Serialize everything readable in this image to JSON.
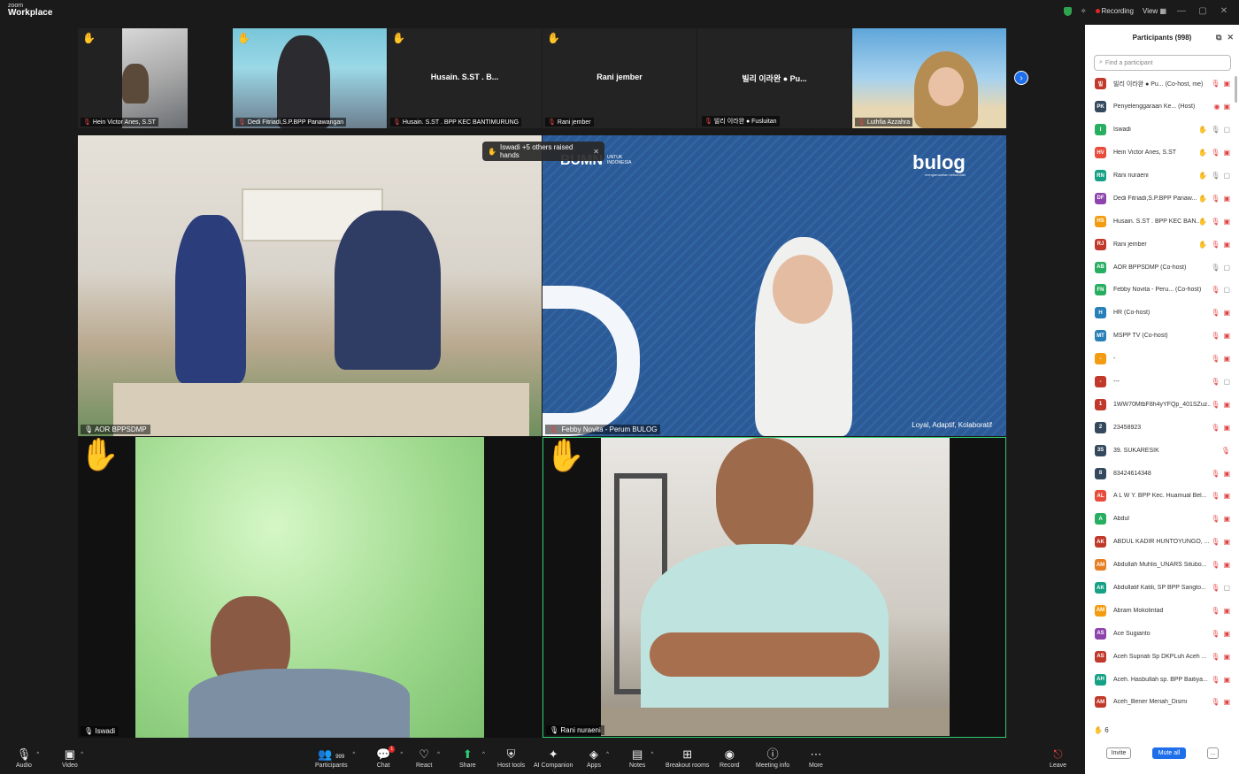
{
  "app": {
    "brand_small": "zoom",
    "brand_big": "Workplace",
    "recording": "Recording",
    "view": "View"
  },
  "toast": {
    "text": "Iswadi +5 others raised hands"
  },
  "thumbs": [
    {
      "name": "Hein Victor Anes, S.ST"
    },
    {
      "name": "Dedi Fitriadi,S.P.BPP Panawangan"
    },
    {
      "name": "Husain. S.ST . BPP KEC BANTIMURUNG",
      "center": "Husain. S.ST . B..."
    },
    {
      "name": "Rani jember",
      "center": "Rani jember"
    },
    {
      "name": "빌리 이라완 ● Fusluitan",
      "center": "빌리 이라완 ● Pu..."
    },
    {
      "name": "Luthfia Azzahra"
    }
  ],
  "tiles": [
    {
      "name": "AOR BPPSDMP"
    },
    {
      "name": "Febby Novita - Perum BULOG",
      "logo": "bulog",
      "logo_sub": "mengamankan kebutuhan",
      "tagline": "Loyal, Adaptif, Kolaboratif",
      "bumn1": "UNTUK",
      "bumn2": "INDONESIA"
    },
    {
      "name": "Iswadi"
    },
    {
      "name": "Rani nuraeni"
    }
  ],
  "sidebar": {
    "title": "Participants (998)",
    "search_placeholder": "Find a participant",
    "raised_count": "6",
    "invite": "Invite",
    "mute_all": "Mute all",
    "more": "...",
    "participants": [
      {
        "initials": "빌",
        "color": "#c0392b",
        "name": "빌리 이라완 ● Pu... (Co-host, me)",
        "s": [
          "mic",
          "cam"
        ]
      },
      {
        "initials": "PK",
        "color": "#34495e",
        "name": "Penyelenggaraan Ke... (Host)",
        "s": [
          "rec",
          "cam"
        ]
      },
      {
        "initials": "I",
        "color": "#27ae60",
        "name": "Iswadi",
        "s": [
          "hand",
          "okmic",
          "okcam"
        ]
      },
      {
        "initials": "HV",
        "color": "#e74c3c",
        "name": "Hein Victor Anes, S.ST",
        "s": [
          "hand",
          "mic",
          "cam"
        ]
      },
      {
        "initials": "RN",
        "color": "#16a085",
        "name": "Rani nuraeni",
        "s": [
          "hand",
          "okmic",
          "okcam"
        ]
      },
      {
        "initials": "DF",
        "color": "#8e44ad",
        "name": "Dedi Fitriadi,S.P.BPP Panaw...",
        "s": [
          "hand",
          "mic",
          "cam"
        ]
      },
      {
        "initials": "HS",
        "color": "#f39c12",
        "name": "Husain. S.ST . BPP KEC BAN...",
        "s": [
          "hand",
          "mic",
          "cam"
        ]
      },
      {
        "initials": "RJ",
        "color": "#c0392b",
        "name": "Rani jember",
        "s": [
          "hand",
          "mic",
          "cam"
        ]
      },
      {
        "initials": "AB",
        "color": "#27ae60",
        "name": "AOR BPPSDMP (Co-host)",
        "s": [
          "okmic",
          "okcam"
        ]
      },
      {
        "initials": "FN",
        "color": "#27ae60",
        "name": "Febby Novita - Peru... (Co-host)",
        "s": [
          "mic",
          "okcam"
        ]
      },
      {
        "initials": "H",
        "color": "#2980b9",
        "name": "HR (Co-host)",
        "s": [
          "mic",
          "cam"
        ]
      },
      {
        "initials": "MT",
        "color": "#2980b9",
        "name": "MSPP TV (Co-host)",
        "s": [
          "mic",
          "cam"
        ]
      },
      {
        "initials": "-",
        "color": "#f39c12",
        "name": "-",
        "s": [
          "mic",
          "cam"
        ]
      },
      {
        "initials": "-",
        "color": "#c0392b",
        "name": "---",
        "s": [
          "mic",
          "okcam"
        ]
      },
      {
        "initials": "1",
        "color": "#c0392b",
        "name": "1WW70MtbF8h4yYFQp_401SZuz...",
        "s": [
          "mic",
          "cam"
        ]
      },
      {
        "initials": "2",
        "color": "#34495e",
        "name": "23458923",
        "s": [
          "mic",
          "cam"
        ]
      },
      {
        "initials": "3S",
        "color": "#34495e",
        "name": "39. SUKARESIK",
        "s": [
          "mic"
        ]
      },
      {
        "initials": "8",
        "color": "#34495e",
        "name": "83424614348",
        "s": [
          "mic",
          "cam"
        ]
      },
      {
        "initials": "AL",
        "color": "#e74c3c",
        "name": "A L W Y. BPP Kec. Huamual Bel...",
        "s": [
          "mic",
          "cam"
        ]
      },
      {
        "initials": "A",
        "color": "#27ae60",
        "name": "Abdul",
        "s": [
          "mic",
          "cam"
        ]
      },
      {
        "initials": "AK",
        "color": "#c0392b",
        "name": "ABDUL KADIR HUNTOYUNGO, ...",
        "s": [
          "mic",
          "cam"
        ]
      },
      {
        "initials": "AM",
        "color": "#e67e22",
        "name": "Abdullah Muhlis_UNARS Situbo...",
        "s": [
          "mic",
          "cam"
        ]
      },
      {
        "initials": "AK",
        "color": "#16a085",
        "name": "Abdullatif Katili, SP BPP Sangto...",
        "s": [
          "mic",
          "okcam"
        ]
      },
      {
        "initials": "AM",
        "color": "#f39c12",
        "name": "Abram Mokolintad",
        "s": [
          "mic",
          "cam"
        ]
      },
      {
        "initials": "AS",
        "color": "#8e44ad",
        "name": "Ace Sugianto",
        "s": [
          "mic",
          "cam"
        ]
      },
      {
        "initials": "AS",
        "color": "#c0392b",
        "name": "Aceh Supriati Sp DKPLuh Aceh ...",
        "s": [
          "mic",
          "cam"
        ]
      },
      {
        "initials": "AH",
        "color": "#16a085",
        "name": "Aceh. Hasbullah sp. BPP Baitiya...",
        "s": [
          "mic",
          "cam"
        ]
      },
      {
        "initials": "AM",
        "color": "#c0392b",
        "name": "Aceh_Bener Meriah_Dismi",
        "s": [
          "mic",
          "cam"
        ]
      }
    ]
  },
  "toolbar": {
    "audio": "Audio",
    "video": "Video",
    "participants": "Participants",
    "participants_count": "999",
    "chat": "Chat",
    "chat_badge": "1",
    "react": "React",
    "share": "Share",
    "host_tools": "Host tools",
    "ai_companion": "AI Companion",
    "apps": "Apps",
    "notes": "Notes",
    "breakout": "Breakout rooms",
    "record": "Record",
    "meeting_info": "Meeting info",
    "more": "More",
    "leave": "Leave"
  }
}
